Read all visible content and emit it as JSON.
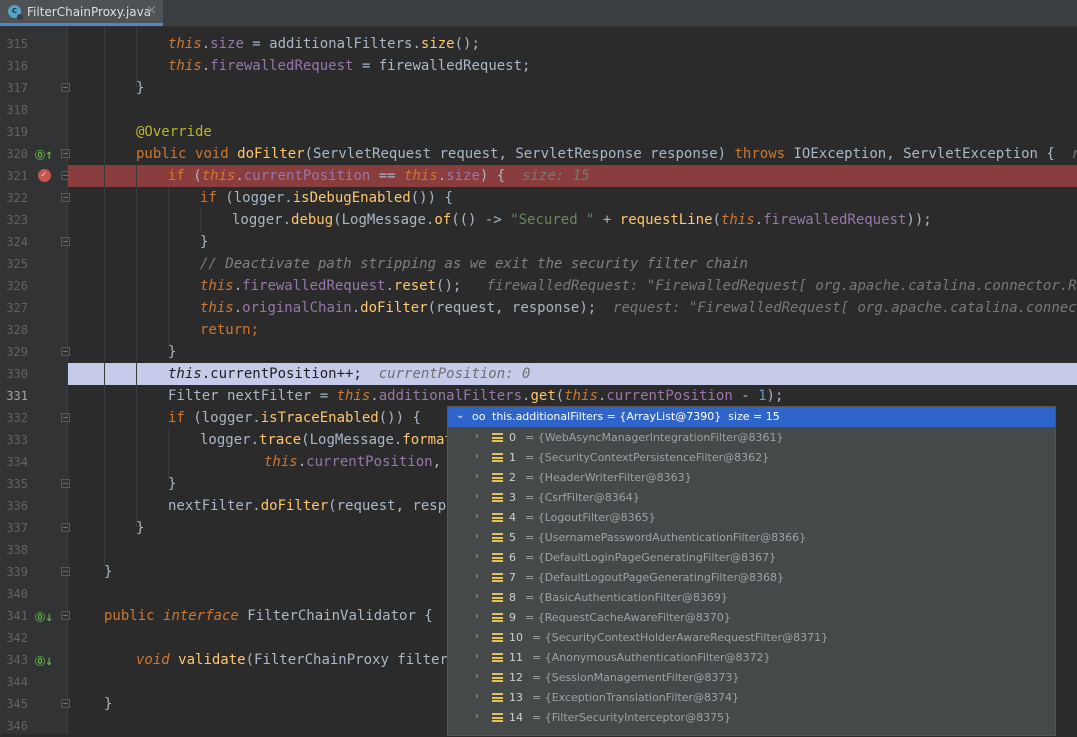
{
  "tab": {
    "label": "FilterChainProxy.java",
    "close": "×"
  },
  "lines": [
    {
      "n": "315"
    },
    {
      "n": "316"
    },
    {
      "n": "317"
    },
    {
      "n": "318"
    },
    {
      "n": "319"
    },
    {
      "n": "320"
    },
    {
      "n": "321"
    },
    {
      "n": "322"
    },
    {
      "n": "323"
    },
    {
      "n": "324"
    },
    {
      "n": "325"
    },
    {
      "n": "326"
    },
    {
      "n": "327"
    },
    {
      "n": "328"
    },
    {
      "n": "329"
    },
    {
      "n": "330"
    },
    {
      "n": "331"
    },
    {
      "n": "332"
    },
    {
      "n": "333"
    },
    {
      "n": "334"
    },
    {
      "n": "335"
    },
    {
      "n": "336"
    },
    {
      "n": "337"
    },
    {
      "n": "338"
    },
    {
      "n": "339"
    },
    {
      "n": "340"
    },
    {
      "n": "341"
    },
    {
      "n": "342"
    },
    {
      "n": "343"
    },
    {
      "n": "344"
    },
    {
      "n": "345"
    },
    {
      "n": "346"
    }
  ],
  "code": {
    "l315": {
      "this": "this",
      "rest": ".",
      "fld": "size",
      "eq": " = additionalFilters.",
      "fn": "size",
      "end": "();"
    },
    "l316": {
      "this": "this",
      "dot": ".",
      "fld": "firewalledRequest",
      "eq": " = firewalledRequest;"
    },
    "l317": "}",
    "l319": "@Override",
    "l320": {
      "kw1": "public",
      "kw2": "void",
      "fn": "doFilter",
      "a": "(ServletRequest request, ServletResponse response) ",
      "kw3": "throws",
      "b": " IOException, ServletException {",
      "hint": "reques"
    },
    "l321": {
      "kw": "if",
      "a": " (",
      "this1": "this",
      "d1": ".",
      "fld1": "currentPosition",
      "eq": " == ",
      "this2": "this",
      "d2": ".",
      "fld2": "size",
      "b": ") {",
      "hint": "size: 15"
    },
    "l322": {
      "kw": "if",
      "a": " (logger.",
      "fn": "isDebugEnabled",
      "b": "()) {"
    },
    "l323": {
      "a": "logger.",
      "fn": "debug",
      "b": "(LogMessage.",
      "fn2": "of",
      "c": "(() -> ",
      "str": "\"Secured \"",
      "d": " + ",
      "fn3": "requestLine",
      "e": "(",
      "this": "this",
      "f": ".",
      "fld": "firewalledRequest",
      "g": "));"
    },
    "l324": "}",
    "l325": "// Deactivate path stripping as we exit the security filter chain",
    "l326": {
      "this": "this",
      "d": ".",
      "fld": "firewalledRequest",
      "a": ".",
      "fn": "reset",
      "b": "();",
      "hint": "firewalledRequest: \"FirewalledRequest[ org.apache.catalina.connector.Request"
    },
    "l327": {
      "this": "this",
      "d": ".",
      "fld": "originalChain",
      "a": ".",
      "fn": "doFilter",
      "b": "(request, response);",
      "hint": "request: \"FirewalledRequest[ org.apache.catalina.connector.R"
    },
    "l328": "return;",
    "l329": "}",
    "l330": {
      "this": "this",
      "rest": ".currentPosition++;",
      "hint": "currentPosition: 0"
    },
    "l331": {
      "a": "Filter nextFilter = ",
      "this1": "this",
      "d1": ".",
      "fld1": "additionalFilters",
      "b": ".",
      "fn": "get",
      "c": "(",
      "this2": "this",
      "d2": ".",
      "fld2": "currentPosition",
      "e": " - ",
      "num": "1",
      "f": ");"
    },
    "l332": {
      "kw": "if",
      "a": " (logger.",
      "fn": "isTraceEnabled",
      "b": "()) {"
    },
    "l333": {
      "a": "logger.",
      "fn": "trace",
      "b": "(LogMessage.",
      "fn2": "format",
      "c": "("
    },
    "l334": {
      "this": "this",
      "d": ".",
      "fld": "currentPosition",
      "a": ", t"
    },
    "l335": "}",
    "l336": {
      "a": "nextFilter.",
      "fn": "doFilter",
      "b": "(request, respon"
    },
    "l337": "}",
    "l339": "}",
    "l341": {
      "kw1": "public",
      "kw2": "interface",
      "name": " FilterChainValidator {"
    },
    "l343": {
      "kw": "void",
      "fn": "validate",
      "a": "(FilterChainProxy filterCh"
    },
    "l345": "}"
  },
  "popup": {
    "header": "this.additionalFilters = {ArrayList@7390}  size = 15",
    "items": [
      {
        "idx": "0",
        "val": "= {WebAsyncManagerIntegrationFilter@8361}"
      },
      {
        "idx": "1",
        "val": "= {SecurityContextPersistenceFilter@8362}"
      },
      {
        "idx": "2",
        "val": "= {HeaderWriterFilter@8363}"
      },
      {
        "idx": "3",
        "val": "= {CsrfFilter@8364}"
      },
      {
        "idx": "4",
        "val": "= {LogoutFilter@8365}"
      },
      {
        "idx": "5",
        "val": "= {UsernamePasswordAuthenticationFilter@8366}"
      },
      {
        "idx": "6",
        "val": "= {DefaultLoginPageGeneratingFilter@8367}"
      },
      {
        "idx": "7",
        "val": "= {DefaultLogoutPageGeneratingFilter@8368}"
      },
      {
        "idx": "8",
        "val": "= {BasicAuthenticationFilter@8369}"
      },
      {
        "idx": "9",
        "val": "= {RequestCacheAwareFilter@8370}"
      },
      {
        "idx": "10",
        "val": "= {SecurityContextHolderAwareRequestFilter@8371}"
      },
      {
        "idx": "11",
        "val": "= {AnonymousAuthenticationFilter@8372}"
      },
      {
        "idx": "12",
        "val": "= {SessionManagementFilter@8373}"
      },
      {
        "idx": "13",
        "val": "= {ExceptionTranslationFilter@8374}"
      },
      {
        "idx": "14",
        "val": "= {FilterSecurityInterceptor@8375}"
      }
    ]
  },
  "colors": {
    "breakpoint_line": "#8a3d3d",
    "execution_line": "#c7cbea",
    "popup_header": "#2f65ca"
  }
}
